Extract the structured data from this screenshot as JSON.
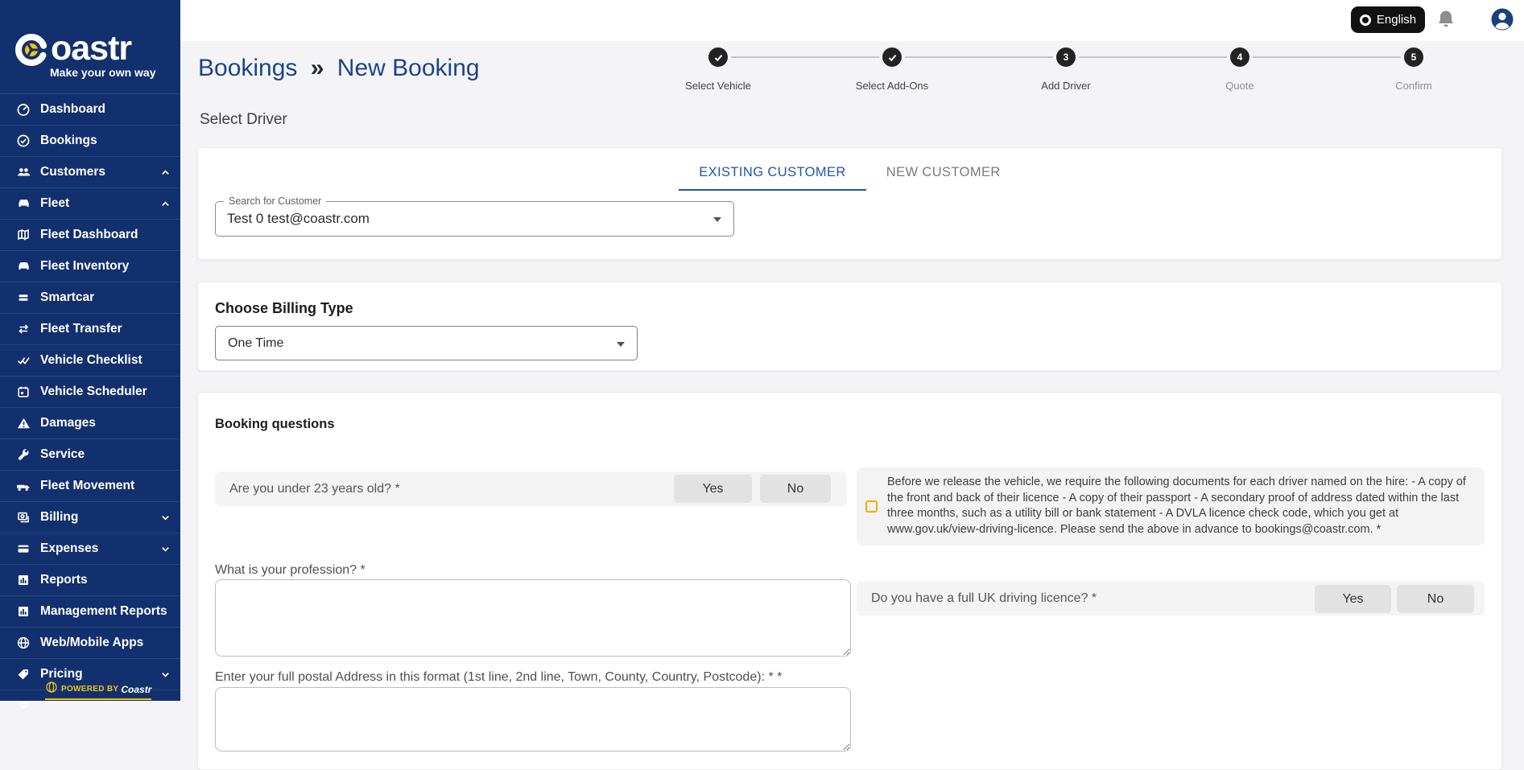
{
  "sidebar": {
    "brand_suffix": "oastr",
    "tagline": "Make your own way",
    "items": [
      {
        "label": "Dashboard"
      },
      {
        "label": "Bookings"
      },
      {
        "label": "Customers"
      },
      {
        "label": "Fleet"
      },
      {
        "label": "Fleet Dashboard"
      },
      {
        "label": "Fleet Inventory"
      },
      {
        "label": "Smartcar"
      },
      {
        "label": "Fleet Transfer"
      },
      {
        "label": "Vehicle Checklist"
      },
      {
        "label": "Vehicle Scheduler"
      },
      {
        "label": "Damages"
      },
      {
        "label": "Service"
      },
      {
        "label": "Fleet Movement"
      },
      {
        "label": "Billing"
      },
      {
        "label": "Expenses"
      },
      {
        "label": "Reports"
      },
      {
        "label": "Management Reports"
      },
      {
        "label": "Web/Mobile Apps"
      },
      {
        "label": "Pricing"
      }
    ],
    "powered_by": "POWERED BY",
    "powered_brand": "Coastr"
  },
  "topbar": {
    "language": "English"
  },
  "breadcrumb": {
    "root": "Bookings",
    "sep": "»",
    "current": "New Booking"
  },
  "page": {
    "subtitle": "Select Driver"
  },
  "stepper": [
    {
      "label": "Select Vehicle",
      "state": "done"
    },
    {
      "label": "Select Add-Ons",
      "state": "done"
    },
    {
      "label": "Add Driver",
      "state": "active",
      "number": "3"
    },
    {
      "label": "Quote",
      "state": "upcoming",
      "number": "4"
    },
    {
      "label": "Confirm",
      "state": "upcoming",
      "number": "5"
    }
  ],
  "customer_card": {
    "tabs": [
      {
        "label": "EXISTING CUSTOMER"
      },
      {
        "label": "NEW CUSTOMER"
      }
    ],
    "search_label": "Search for Customer",
    "search_value": "Test 0 test@coastr.com"
  },
  "billing_card": {
    "title": "Choose Billing Type",
    "value": "One Time"
  },
  "questions_card": {
    "title": "Booking questions",
    "yes": "Yes",
    "no": "No",
    "q_age": "Are you under 23 years old? *",
    "info_text": "Before we release the vehicle, we require the following documents for each driver named on the hire: - A copy of the front and back of their licence - A copy of their passport - A secondary proof of address dated within the last three months, such as a utility bill or bank statement - A DVLA licence check code, which you get at www.gov.uk/view-driving-licence. Please send the above in advance to bookings@coastr.com. *",
    "q_profession": "What is your profession? *",
    "q_licence": "Do you have a full UK driving licence? *",
    "q_address": "Enter your full postal Address in this format (1st line, 2nd line, Town, County, Country, Postcode): * *"
  },
  "colors": {
    "sidebar_navy": "#12306e",
    "brand_yellow": "#f1c116",
    "link_blue": "#1b4489",
    "tab_blue": "#2156a4",
    "step_dark": "#232323",
    "checkbox_amber": "#eeae01"
  }
}
